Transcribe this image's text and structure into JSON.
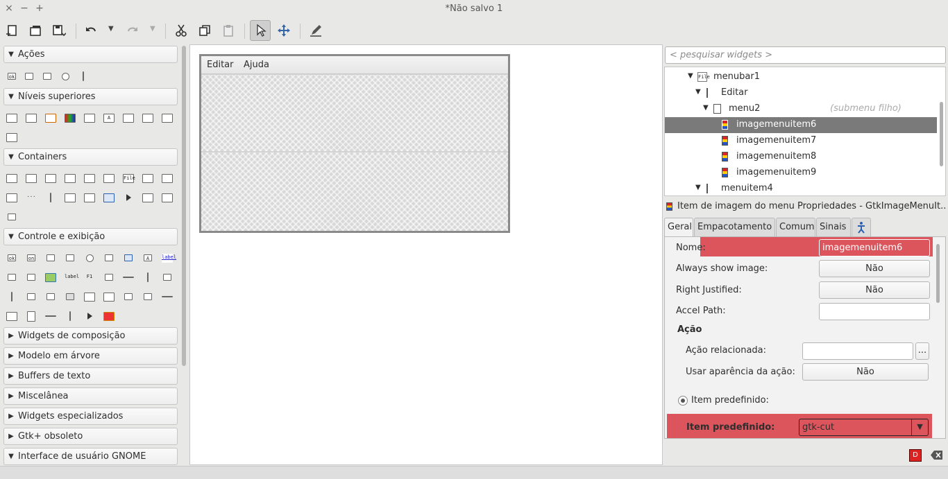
{
  "window": {
    "title": "*Não salvo 1",
    "controls": {
      "close": "×",
      "minimize": "−",
      "maximize": "+"
    }
  },
  "toolbar": {
    "buttons": [
      "new-icon",
      "open-icon",
      "save-icon",
      "undo-icon",
      "redo-icon",
      "cut-icon",
      "copy-icon",
      "paste-icon",
      "select-icon",
      "drag-resize-icon",
      "edit-icon"
    ],
    "active": "select-icon"
  },
  "palette": {
    "sections": [
      {
        "label": "Ações",
        "expanded": true
      },
      {
        "label": "Níveis superiores",
        "expanded": true
      },
      {
        "label": "Containers",
        "expanded": true
      },
      {
        "label": "Controle e exibição",
        "expanded": true
      },
      {
        "label": "Widgets de composição",
        "expanded": false
      },
      {
        "label": "Modelo em árvore",
        "expanded": false
      },
      {
        "label": "Buffers de texto",
        "expanded": false
      },
      {
        "label": "Miscelânea",
        "expanded": false
      },
      {
        "label": "Widgets especializados",
        "expanded": false
      },
      {
        "label": "Gtk+ obsoleto",
        "expanded": false
      },
      {
        "label": "Interface de usuário GNOME",
        "expanded": true
      }
    ],
    "glyphs": {
      "file": "File",
      "ok": "ok",
      "on": "on",
      "label": "label",
      "f1": "F1",
      "dots": "···"
    }
  },
  "canvas": {
    "menubar": [
      "Editar",
      "Ajuda"
    ]
  },
  "search": {
    "placeholder": "< pesquisar widgets >"
  },
  "tree": {
    "rows": [
      {
        "label": "menubar1",
        "icon": "File"
      },
      {
        "label": "Editar"
      },
      {
        "label": "menu2",
        "hint": "(submenu filho)"
      },
      {
        "label": "imagemenuitem6",
        "selected": true
      },
      {
        "label": "imagemenuitem7"
      },
      {
        "label": "imagemenuitem8"
      },
      {
        "label": "imagemenuitem9"
      },
      {
        "label": "menuitem4"
      }
    ]
  },
  "properties": {
    "header": "Item de imagem do menu Propriedades - GtkImageMenuIt...",
    "tabs": [
      "Geral",
      "Empacotamento",
      "Comum",
      "Sinais"
    ],
    "active_tab": "Geral",
    "name_label": "Nome:",
    "name_value": "imagemenuitem6",
    "always_show_label": "Always show image:",
    "always_show_value": "Não",
    "right_justified_label": "Right Justified:",
    "right_justified_value": "Não",
    "accel_path_label": "Accel Path:",
    "accel_path_value": "",
    "acao_heading": "Ação",
    "related_action_label": "Ação relacionada:",
    "related_action_value": "",
    "related_action_button": "...",
    "use_appearance_label": "Usar aparência da ação:",
    "use_appearance_value": "Não",
    "stock_radio_label": "Item predefinido:",
    "stock_item_label": "Item predefinido:",
    "stock_item_value": "gtk-cut",
    "highlight_color": "#d62832"
  }
}
